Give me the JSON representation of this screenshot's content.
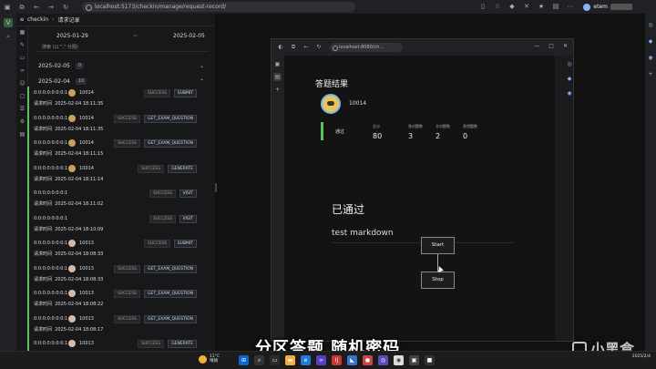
{
  "browser": {
    "url": "localhost:5173/checkin/manage/request-record/",
    "profile_name": "etem"
  },
  "app": {
    "title": "checkin",
    "page": "请求记录",
    "date_from": "2025-01-29",
    "date_to": "2025-02-05",
    "date_sep": "~",
    "search_placeholder": "搜索 (以 \",\" 分隔)",
    "groups": [
      {
        "date": "2025-02-05",
        "count": "0",
        "expanded": false
      },
      {
        "date": "2025-02-04",
        "count": "10",
        "expanded": true
      }
    ],
    "records": [
      {
        "ip": "0:0:0:0:0:0:0:1",
        "uid": "10014",
        "status": "SUCCESS",
        "type": "SUBMIT",
        "time_label": "请求时间",
        "time": "2025-02-04 18:11:35",
        "avatar": "a"
      },
      {
        "ip": "0:0:0:0:0:0:0:1",
        "uid": "10014",
        "status": "SUCCESS",
        "type": "GET_EXAM_QUESTION",
        "time_label": "请求时间",
        "time": "2025-02-04 18:11:35",
        "avatar": "a"
      },
      {
        "ip": "0:0:0:0:0:0:0:1",
        "uid": "10014",
        "status": "SUCCESS",
        "type": "GET_EXAM_QUESTION",
        "time_label": "请求时间",
        "time": "2025-02-04 18:11:15",
        "avatar": "a"
      },
      {
        "ip": "0:0:0:0:0:0:0:1",
        "uid": "10014",
        "status": "SUCCESS",
        "type": "GENERATE",
        "time_label": "请求时间",
        "time": "2025-02-04 18:11:14",
        "avatar": "a"
      },
      {
        "ip": "0:0:0:0:0:0:0:1",
        "uid": "",
        "status": "SUCCESS",
        "type": "VISIT",
        "time_label": "请求时间",
        "time": "2025-02-04 18:11:02",
        "avatar": ""
      },
      {
        "ip": "0:0:0:0:0:0:0:1",
        "uid": "",
        "status": "SUCCESS",
        "type": "VISIT",
        "time_label": "请求时间",
        "time": "2025-02-04 18:10:09",
        "avatar": ""
      },
      {
        "ip": "0:0:0:0:0:0:0:1",
        "uid": "10013",
        "status": "SUCCESS",
        "type": "SUBMIT",
        "time_label": "请求时间",
        "time": "2025-02-04 18:08:33",
        "avatar": "b"
      },
      {
        "ip": "0:0:0:0:0:0:0:1",
        "uid": "10013",
        "status": "SUCCESS",
        "type": "GET_EXAM_QUESTION",
        "time_label": "请求时间",
        "time": "2025-02-04 18:08:33",
        "avatar": "b"
      },
      {
        "ip": "0:0:0:0:0:0:0:1",
        "uid": "10013",
        "status": "SUCCESS",
        "type": "GET_EXAM_QUESTION",
        "time_label": "请求时间",
        "time": "2025-02-04 18:08:22",
        "avatar": "b"
      },
      {
        "ip": "0:0:0:0:0:0:0:1",
        "uid": "10013",
        "status": "SUCCESS",
        "type": "GET_EXAM_QUESTION",
        "time_label": "请求时间",
        "time": "2025-02-04 18:08:17",
        "avatar": "b"
      },
      {
        "ip": "0:0:0:0:0:0:0:1",
        "uid": "10013",
        "status": "SUCCESS",
        "type": "GENERATE",
        "time_label": "",
        "time": "",
        "avatar": "b"
      }
    ]
  },
  "inner": {
    "url": "localhost:8080/ch...",
    "result_title": "答题结果",
    "uid": "10014",
    "pass_label": "通过",
    "stats": [
      {
        "label": "总分",
        "value": "80"
      },
      {
        "label": "答对题数",
        "value": "3"
      },
      {
        "label": "半对题数",
        "value": "2"
      },
      {
        "label": "答错题数",
        "value": "0"
      }
    ],
    "passed_text": "已通过",
    "markdown_text": "test markdown",
    "start_label": "Start",
    "stop_label": "Stop"
  },
  "overlay": {
    "caption": "分区答题 随机密码",
    "watermark": "小黑盒"
  },
  "taskbar": {
    "temp": "11°C",
    "weather": "晴朗",
    "date": "2025/2/4"
  },
  "colors": {
    "success": "#5bbf5b",
    "accent": "#8ab4f8"
  }
}
